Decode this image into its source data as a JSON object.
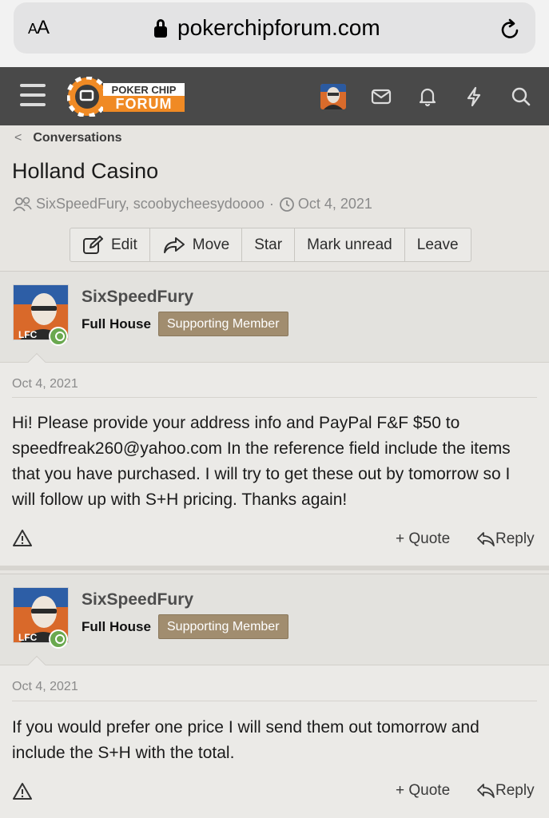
{
  "browser": {
    "aa_label_small": "A",
    "aa_label_large": "A",
    "domain": "pokerchipforum.com"
  },
  "header": {
    "logo_top": "POKER CHIP",
    "logo_bottom": "FORUM"
  },
  "breadcrumb": {
    "label": "Conversations"
  },
  "conversation": {
    "title": "Holland Casino",
    "participants": "SixSpeedFury, scoobycheesydoooo",
    "dot": "·",
    "date": "Oct 4, 2021"
  },
  "actions": {
    "edit": "Edit",
    "move": "Move",
    "star": "Star",
    "mark_unread": "Mark unread",
    "leave": "Leave"
  },
  "messages": [
    {
      "username": "SixSpeedFury",
      "user_title": "Full House",
      "banner": "Supporting Member",
      "date": "Oct 4, 2021",
      "text": "Hi! Please provide your address info and PayPal F&F $50 to speedfreak260@yahoo.com In the reference field include the items that you have purchased. I will try to get these out by tomorrow so I will follow up with S+H pricing. Thanks again!",
      "quote": "+ Quote",
      "reply": "Reply"
    },
    {
      "username": "SixSpeedFury",
      "user_title": "Full House",
      "banner": "Supporting Member",
      "date": "Oct 4, 2021",
      "text": "If you would prefer one price I will send them out tomorrow and include the S+H with the total.",
      "quote": "+ Quote",
      "reply": "Reply"
    }
  ],
  "colors": {
    "header_bg": "#494949",
    "banner_bg": "#a18d6f",
    "logo_orange": "#f08a24",
    "online_green": "#6aa84f"
  }
}
